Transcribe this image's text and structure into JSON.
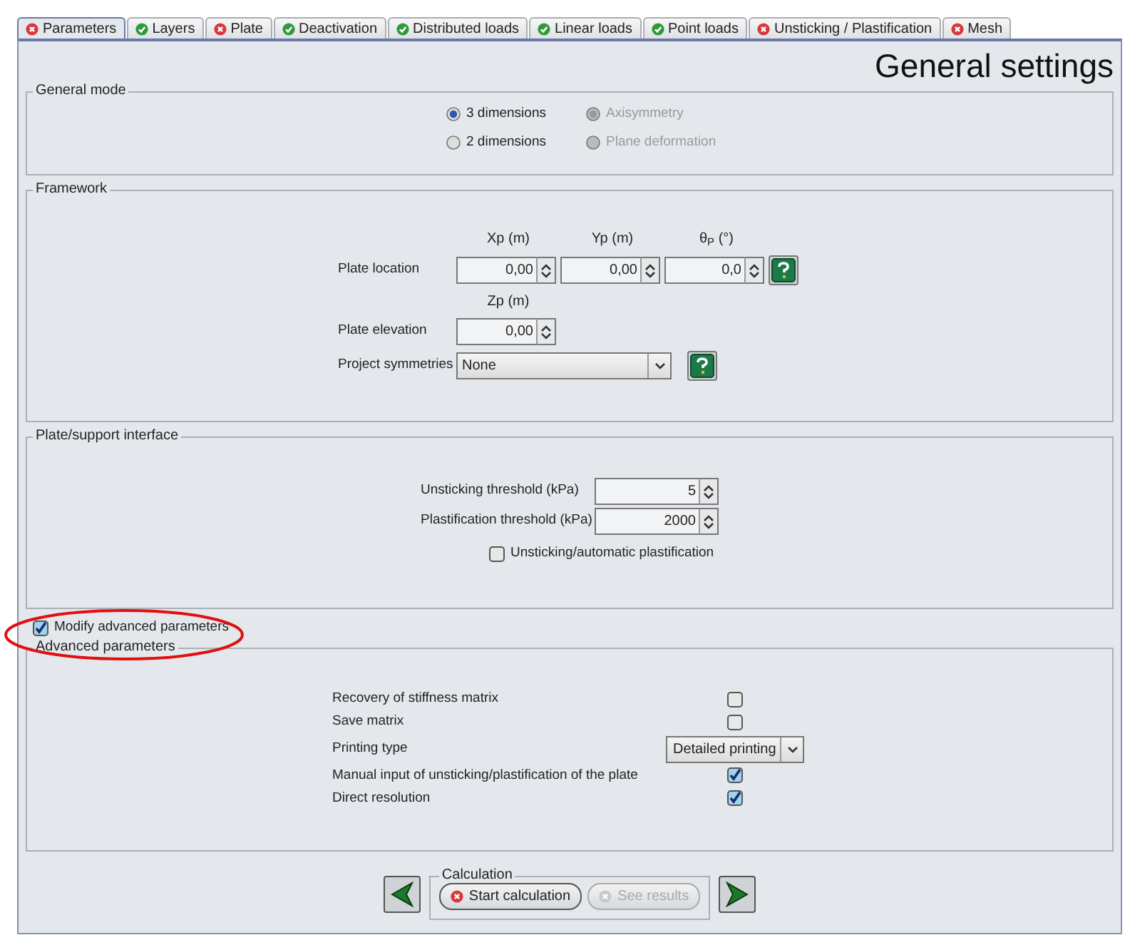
{
  "tabs": [
    {
      "label": "Parameters",
      "has_error": true,
      "selected": true
    },
    {
      "label": "Layers",
      "has_error": false,
      "selected": false
    },
    {
      "label": "Plate",
      "has_error": true,
      "selected": false
    },
    {
      "label": "Deactivation",
      "has_error": false,
      "selected": false
    },
    {
      "label": "Distributed loads",
      "has_error": false,
      "selected": false
    },
    {
      "label": "Linear loads",
      "has_error": false,
      "selected": false
    },
    {
      "label": "Point loads",
      "has_error": false,
      "selected": false
    },
    {
      "label": "Unsticking / Plastification",
      "has_error": true,
      "selected": false
    },
    {
      "label": "Mesh",
      "has_error": true,
      "selected": false
    }
  ],
  "title": "General settings",
  "general_mode": {
    "legend": "General mode",
    "options": [
      {
        "label": "3 dimensions",
        "selected": true,
        "disabled": false
      },
      {
        "label": "Axisymmetry",
        "selected": true,
        "disabled": true
      },
      {
        "label": "2 dimensions",
        "selected": false,
        "disabled": false
      },
      {
        "label": "Plane deformation",
        "selected": false,
        "disabled": true
      }
    ]
  },
  "framework": {
    "legend": "Framework",
    "headers": [
      "Xp (m)",
      "Yp (m)",
      "θ$_{P}$ (°)"
    ],
    "plate_location": {
      "label": "Plate location",
      "values": [
        "0,00",
        "0,00",
        "0,0"
      ]
    },
    "elevation_header": "Zp (m)",
    "plate_elevation": {
      "label": "Plate elevation",
      "value": "0,00"
    },
    "symmetries": {
      "label": "Project symmetries",
      "value": "None"
    }
  },
  "interface": {
    "legend": "Plate/support interface",
    "fields": [
      {
        "label": "Unsticking threshold (kPa)",
        "value": "5"
      },
      {
        "label": "Plastification threshold (kPa)",
        "value": "2000"
      }
    ],
    "checkbox": {
      "label": "Unsticking/automatic plastification",
      "checked": false
    }
  },
  "modify_advanced": {
    "label": "Modify advanced parameters",
    "checked": true
  },
  "advanced": {
    "legend": "Advanced parameters",
    "rows": [
      {
        "kind": "checkbox",
        "label": "Recovery of stiffness matrix",
        "checked": false
      },
      {
        "kind": "checkbox",
        "label": "Save matrix",
        "checked": false
      },
      {
        "kind": "select",
        "label": "Printing type",
        "value": "Detailed printing"
      },
      {
        "kind": "checkbox",
        "label": "Manual input of unsticking/plastification of the plate",
        "checked": true
      },
      {
        "kind": "checkbox",
        "label": "Direct resolution",
        "checked": true
      }
    ]
  },
  "calculation": {
    "legend": "Calculation",
    "buttons": [
      {
        "label": "Start calculation",
        "disabled": false
      },
      {
        "label": "See results",
        "disabled": true
      }
    ]
  }
}
